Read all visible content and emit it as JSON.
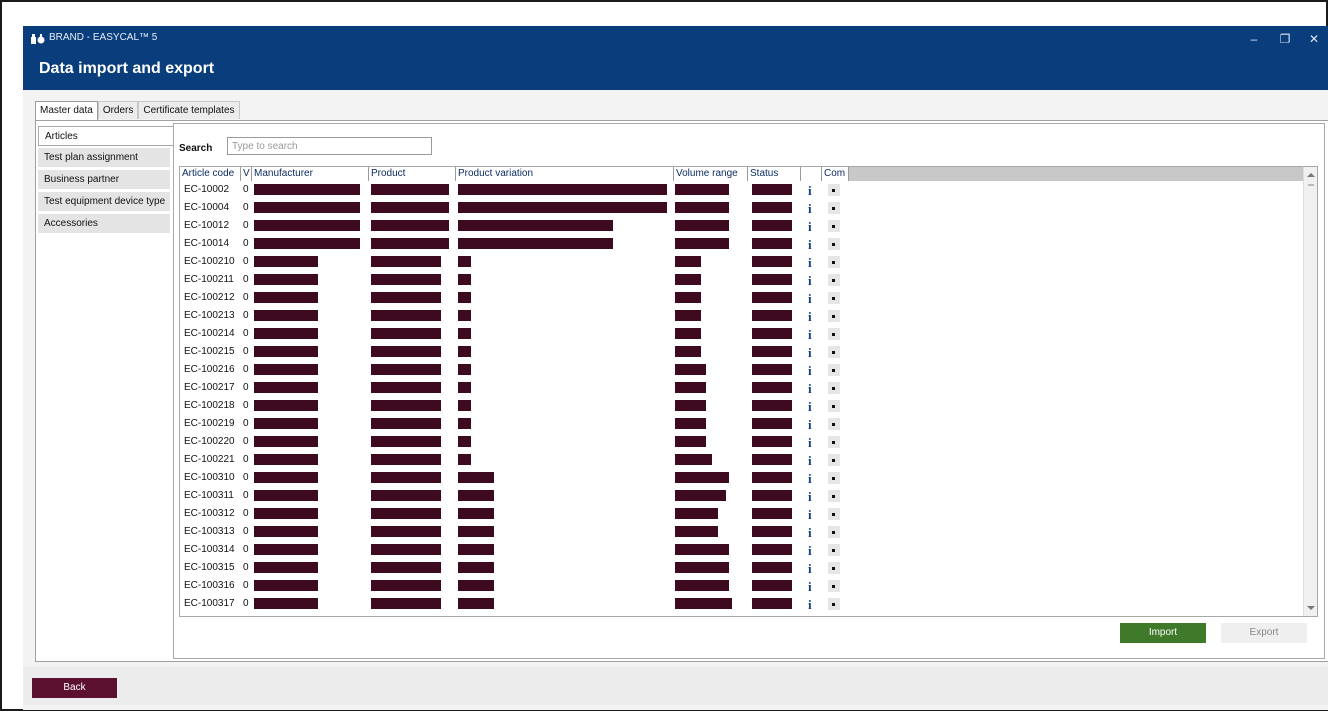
{
  "window": {
    "app_title": "BRAND - EASYCAL™ 5",
    "page_title": "Data import and export",
    "controls": {
      "minimize": "–",
      "restore": "❐",
      "close": "✕"
    }
  },
  "tabs": [
    "Master data",
    "Orders",
    "Certificate templates"
  ],
  "sidebar": [
    "Articles",
    "Test plan assignment",
    "Business partner",
    "Test equipment device type",
    "Accessories"
  ],
  "search": {
    "label": "Search",
    "placeholder": "Type to search"
  },
  "table": {
    "columns": [
      "Article code",
      "V",
      "Manufacturer",
      "Product",
      "Product variation",
      "Volume range",
      "Status",
      "",
      "Com"
    ],
    "rows": [
      {
        "code": "EC-10002",
        "v": "0",
        "mf": 1.0,
        "pr": 1.0,
        "pv": 1.0,
        "vr": 0.95,
        "st": 1.0
      },
      {
        "code": "EC-10004",
        "v": "0",
        "mf": 1.0,
        "pr": 1.0,
        "pv": 1.0,
        "vr": 0.95,
        "st": 1.0
      },
      {
        "code": "EC-10012",
        "v": "0",
        "mf": 1.0,
        "pr": 1.0,
        "pv": 0.74,
        "vr": 0.95,
        "st": 1.0
      },
      {
        "code": "EC-10014",
        "v": "0",
        "mf": 1.0,
        "pr": 1.0,
        "pv": 0.74,
        "vr": 0.95,
        "st": 1.0
      },
      {
        "code": "EC-100210",
        "v": "0",
        "mf": 0.6,
        "pr": 0.9,
        "pv": 0.06,
        "vr": 0.45,
        "st": 1.0
      },
      {
        "code": "EC-100211",
        "v": "0",
        "mf": 0.6,
        "pr": 0.9,
        "pv": 0.06,
        "vr": 0.45,
        "st": 1.0
      },
      {
        "code": "EC-100212",
        "v": "0",
        "mf": 0.6,
        "pr": 0.9,
        "pv": 0.06,
        "vr": 0.45,
        "st": 1.0
      },
      {
        "code": "EC-100213",
        "v": "0",
        "mf": 0.6,
        "pr": 0.9,
        "pv": 0.06,
        "vr": 0.45,
        "st": 1.0
      },
      {
        "code": "EC-100214",
        "v": "0",
        "mf": 0.6,
        "pr": 0.9,
        "pv": 0.06,
        "vr": 0.45,
        "st": 1.0
      },
      {
        "code": "EC-100215",
        "v": "0",
        "mf": 0.6,
        "pr": 0.9,
        "pv": 0.06,
        "vr": 0.45,
        "st": 1.0
      },
      {
        "code": "EC-100216",
        "v": "0",
        "mf": 0.6,
        "pr": 0.9,
        "pv": 0.06,
        "vr": 0.55,
        "st": 1.0
      },
      {
        "code": "EC-100217",
        "v": "0",
        "mf": 0.6,
        "pr": 0.9,
        "pv": 0.06,
        "vr": 0.55,
        "st": 1.0
      },
      {
        "code": "EC-100218",
        "v": "0",
        "mf": 0.6,
        "pr": 0.9,
        "pv": 0.06,
        "vr": 0.55,
        "st": 1.0
      },
      {
        "code": "EC-100219",
        "v": "0",
        "mf": 0.6,
        "pr": 0.9,
        "pv": 0.06,
        "vr": 0.55,
        "st": 1.0
      },
      {
        "code": "EC-100220",
        "v": "0",
        "mf": 0.6,
        "pr": 0.9,
        "pv": 0.06,
        "vr": 0.55,
        "st": 1.0
      },
      {
        "code": "EC-100221",
        "v": "0",
        "mf": 0.6,
        "pr": 0.9,
        "pv": 0.06,
        "vr": 0.65,
        "st": 1.0
      },
      {
        "code": "EC-100310",
        "v": "0",
        "mf": 0.6,
        "pr": 0.9,
        "pv": 0.17,
        "vr": 0.95,
        "st": 1.0
      },
      {
        "code": "EC-100311",
        "v": "0",
        "mf": 0.6,
        "pr": 0.9,
        "pv": 0.17,
        "vr": 0.9,
        "st": 1.0
      },
      {
        "code": "EC-100312",
        "v": "0",
        "mf": 0.6,
        "pr": 0.9,
        "pv": 0.17,
        "vr": 0.75,
        "st": 1.0
      },
      {
        "code": "EC-100313",
        "v": "0",
        "mf": 0.6,
        "pr": 0.9,
        "pv": 0.17,
        "vr": 0.75,
        "st": 1.0
      },
      {
        "code": "EC-100314",
        "v": "0",
        "mf": 0.6,
        "pr": 0.9,
        "pv": 0.17,
        "vr": 0.95,
        "st": 1.0
      },
      {
        "code": "EC-100315",
        "v": "0",
        "mf": 0.6,
        "pr": 0.9,
        "pv": 0.17,
        "vr": 0.95,
        "st": 1.0
      },
      {
        "code": "EC-100316",
        "v": "0",
        "mf": 0.6,
        "pr": 0.9,
        "pv": 0.17,
        "vr": 0.95,
        "st": 1.0
      },
      {
        "code": "EC-100317",
        "v": "0",
        "mf": 0.6,
        "pr": 0.9,
        "pv": 0.17,
        "vr": 1.0,
        "st": 1.0
      }
    ],
    "info_icon": "i"
  },
  "buttons": {
    "import": "Import",
    "export": "Export",
    "back": "Back"
  },
  "colors": {
    "titlebar": "#0a3d7c",
    "redaction": "#3d0a1f",
    "import": "#3f7a2a",
    "back": "#5c1030"
  }
}
